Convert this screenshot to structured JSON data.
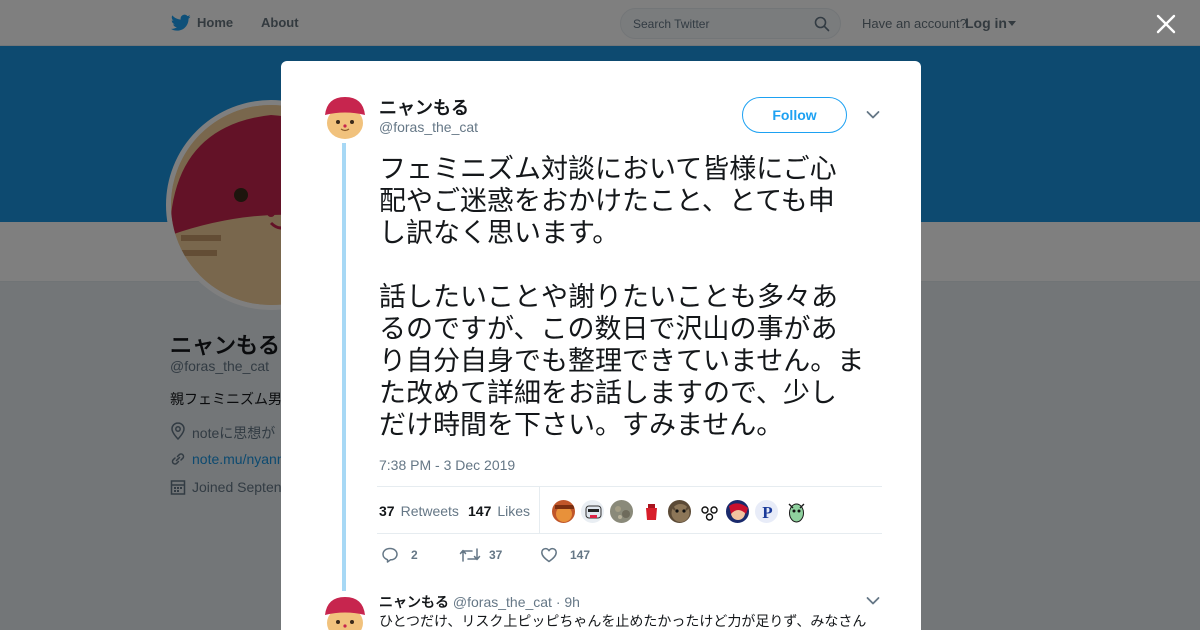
{
  "nav": {
    "home": "Home",
    "about": "About",
    "search_placeholder": "Search Twitter",
    "have_account": "Have an account?",
    "login": "Log in"
  },
  "profile": {
    "name": "ニャンもる",
    "handle": "@foras_the_cat",
    "bio": "親フェミニズム男",
    "location": "noteに思想が",
    "link": "note.mu/nyann",
    "joined": "Joined Septen"
  },
  "tweet": {
    "author_name": "ニャンもる",
    "author_handle": "@foras_the_cat",
    "follow_label": "Follow",
    "text": "フェミニズム対談において皆様にご心\n配やご迷惑をおかけたこと、とても申\nし訳なく思います。\n\n話したいことや謝りたいことも多々あ\nるのですが、この数日で沢山の事があ\nり自分自身でも整理できていません。ま\nた改めて詳細をお話しますので、少し\nだけ時間を下さい。すみません。",
    "timestamp": "7:38 PM - 3 Dec 2019",
    "retweets_count": "37",
    "retweets_label": "Retweets",
    "likes_count": "147",
    "likes_label": "Likes",
    "reply_count": "2",
    "retweet_action_count": "37",
    "like_action_count": "147",
    "liker_avatars": [
      "avatar-1",
      "avatar-2",
      "avatar-3",
      "avatar-4",
      "avatar-5",
      "avatar-6",
      "avatar-7",
      "avatar-8-P",
      "avatar-9"
    ],
    "liker_letter": "P"
  },
  "reply": {
    "author_name": "ニャンもる",
    "author_handle": "@foras_the_cat",
    "time": "· 9h",
    "text": "ひとつだけ、リスク上ピッピちゃんを止めたかったけど力が足りず、みなさん"
  },
  "colors": {
    "accent": "#1da1f2",
    "banner": "#1b95e0",
    "overlay": "rgba(0,0,0,0.5)"
  }
}
